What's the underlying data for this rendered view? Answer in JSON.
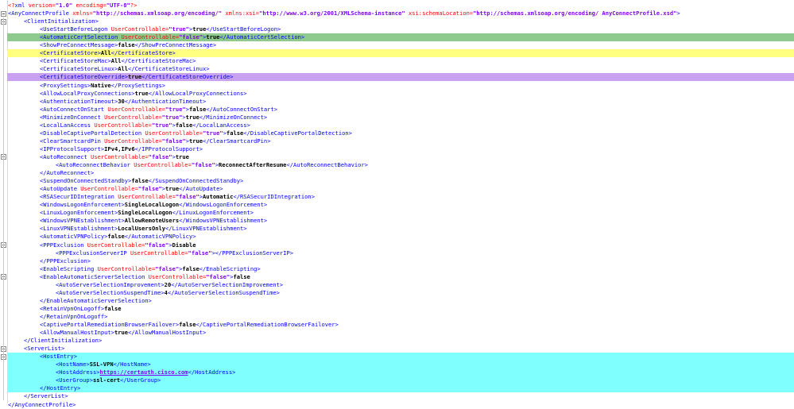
{
  "editor": {
    "lines": [
      {
        "indent": 0,
        "highlight": "",
        "segments": [
          {
            "k": "q",
            "t": "<?"
          },
          {
            "k": "b",
            "t": "xml "
          },
          {
            "k": "a",
            "t": "version="
          },
          {
            "k": "v",
            "t": "\"1.0\""
          },
          {
            "k": "a",
            "t": " encoding="
          },
          {
            "k": "v",
            "t": "\"UTF-8\""
          },
          {
            "k": "q",
            "t": "?>"
          }
        ]
      },
      {
        "indent": 0,
        "highlight": "",
        "segments": [
          {
            "k": "b",
            "t": "<AnyConnectProfile "
          },
          {
            "k": "a",
            "t": "xmlns="
          },
          {
            "k": "v",
            "t": "\"http://schemas.xmlsoap.org/encoding/\""
          },
          {
            "k": "a",
            "t": " xmlns:xsi="
          },
          {
            "k": "v",
            "t": "\"http://www.w3.org/2001/XMLSchema-instance\""
          },
          {
            "k": "a",
            "t": " xsi:schemaLocation="
          },
          {
            "k": "v",
            "t": "\"http://schemas.xmlsoap.org/encoding/ AnyConnectProfile.xsd\""
          },
          {
            "k": "b",
            "t": ">"
          }
        ]
      },
      {
        "indent": 1,
        "highlight": "",
        "segments": [
          {
            "k": "b",
            "t": "<ClientInitialization>"
          }
        ]
      },
      {
        "indent": 2,
        "highlight": "",
        "segments": [
          {
            "k": "b",
            "t": "<UseStartBeforeLogon "
          },
          {
            "k": "a",
            "t": "UserControllable="
          },
          {
            "k": "v",
            "t": "\"true\""
          },
          {
            "k": "b",
            "t": ">"
          },
          {
            "k": "t",
            "t": "true"
          },
          {
            "k": "b",
            "t": "</UseStartBeforeLogon>"
          }
        ]
      },
      {
        "indent": 2,
        "highlight": "green",
        "segments": [
          {
            "k": "b",
            "t": "<AutomaticCertSelection "
          },
          {
            "k": "a",
            "t": "UserControllable="
          },
          {
            "k": "v",
            "t": "\"false\""
          },
          {
            "k": "b",
            "t": ">"
          },
          {
            "k": "t",
            "t": "true"
          },
          {
            "k": "b",
            "t": "</AutomaticCertSelection>"
          }
        ]
      },
      {
        "indent": 2,
        "highlight": "",
        "segments": [
          {
            "k": "b",
            "t": "<ShowPreConnectMessage>"
          },
          {
            "k": "t",
            "t": "false"
          },
          {
            "k": "b",
            "t": "</ShowPreConnectMessage>"
          }
        ]
      },
      {
        "indent": 2,
        "highlight": "yellow",
        "segments": [
          {
            "k": "b",
            "t": "<CertificateStore>"
          },
          {
            "k": "t",
            "t": "All"
          },
          {
            "k": "b",
            "t": "</CertificateStore>"
          }
        ]
      },
      {
        "indent": 2,
        "highlight": "",
        "segments": [
          {
            "k": "b",
            "t": "<CertificateStoreMac>"
          },
          {
            "k": "t",
            "t": "All"
          },
          {
            "k": "b",
            "t": "</CertificateStoreMac>"
          }
        ]
      },
      {
        "indent": 2,
        "highlight": "",
        "segments": [
          {
            "k": "b",
            "t": "<CertificateStoreLinux>"
          },
          {
            "k": "t",
            "t": "All"
          },
          {
            "k": "b",
            "t": "</CertificateStoreLinux>"
          }
        ]
      },
      {
        "indent": 2,
        "highlight": "purple",
        "segments": [
          {
            "k": "b",
            "t": "<CertificateStoreOverride>"
          },
          {
            "k": "t",
            "t": "true"
          },
          {
            "k": "b",
            "t": "</CertificateStoreOverride>"
          }
        ]
      },
      {
        "indent": 2,
        "highlight": "",
        "segments": [
          {
            "k": "b",
            "t": "<ProxySettings>"
          },
          {
            "k": "t",
            "t": "Native"
          },
          {
            "k": "b",
            "t": "</ProxySettings>"
          }
        ]
      },
      {
        "indent": 2,
        "highlight": "",
        "segments": [
          {
            "k": "b",
            "t": "<AllowLocalProxyConnections>"
          },
          {
            "k": "t",
            "t": "true"
          },
          {
            "k": "b",
            "t": "</AllowLocalProxyConnections>"
          }
        ]
      },
      {
        "indent": 2,
        "highlight": "",
        "segments": [
          {
            "k": "b",
            "t": "<AuthenticationTimeout>"
          },
          {
            "k": "t",
            "t": "30"
          },
          {
            "k": "b",
            "t": "</AuthenticationTimeout>"
          }
        ]
      },
      {
        "indent": 2,
        "highlight": "",
        "segments": [
          {
            "k": "b",
            "t": "<AutoConnectOnStart "
          },
          {
            "k": "a",
            "t": "UserControllable="
          },
          {
            "k": "v",
            "t": "\"true\""
          },
          {
            "k": "b",
            "t": ">"
          },
          {
            "k": "t",
            "t": "false"
          },
          {
            "k": "b",
            "t": "</AutoConnectOnStart>"
          }
        ]
      },
      {
        "indent": 2,
        "highlight": "",
        "segments": [
          {
            "k": "b",
            "t": "<MinimizeOnConnect "
          },
          {
            "k": "a",
            "t": "UserControllable="
          },
          {
            "k": "v",
            "t": "\"true\""
          },
          {
            "k": "b",
            "t": ">"
          },
          {
            "k": "t",
            "t": "true"
          },
          {
            "k": "b",
            "t": "</MinimizeOnConnect>"
          }
        ]
      },
      {
        "indent": 2,
        "highlight": "",
        "segments": [
          {
            "k": "b",
            "t": "<LocalLanAccess "
          },
          {
            "k": "a",
            "t": "UserControllable="
          },
          {
            "k": "v",
            "t": "\"true\""
          },
          {
            "k": "b",
            "t": ">"
          },
          {
            "k": "t",
            "t": "false"
          },
          {
            "k": "b",
            "t": "</LocalLanAccess>"
          }
        ]
      },
      {
        "indent": 2,
        "highlight": "",
        "segments": [
          {
            "k": "b",
            "t": "<DisableCaptivePortalDetection "
          },
          {
            "k": "a",
            "t": "UserControllable="
          },
          {
            "k": "v",
            "t": "\"true\""
          },
          {
            "k": "b",
            "t": ">"
          },
          {
            "k": "t",
            "t": "false"
          },
          {
            "k": "b",
            "t": "</DisableCaptivePortalDetection>"
          }
        ]
      },
      {
        "indent": 2,
        "highlight": "",
        "segments": [
          {
            "k": "b",
            "t": "<ClearSmartcardPin "
          },
          {
            "k": "a",
            "t": "UserControllable="
          },
          {
            "k": "v",
            "t": "\"false\""
          },
          {
            "k": "b",
            "t": ">"
          },
          {
            "k": "t",
            "t": "true"
          },
          {
            "k": "b",
            "t": "</ClearSmartcardPin>"
          }
        ]
      },
      {
        "indent": 2,
        "highlight": "",
        "segments": [
          {
            "k": "b",
            "t": "<IPProtocolSupport>"
          },
          {
            "k": "t",
            "t": "IPv4,IPv6"
          },
          {
            "k": "b",
            "t": "</IPProtocolSupport>"
          }
        ]
      },
      {
        "indent": 2,
        "highlight": "",
        "segments": [
          {
            "k": "b",
            "t": "<AutoReconnect "
          },
          {
            "k": "a",
            "t": "UserControllable="
          },
          {
            "k": "v",
            "t": "\"false\""
          },
          {
            "k": "b",
            "t": ">"
          },
          {
            "k": "t",
            "t": "true"
          }
        ]
      },
      {
        "indent": 3,
        "highlight": "",
        "segments": [
          {
            "k": "b",
            "t": "<AutoReconnectBehavior "
          },
          {
            "k": "a",
            "t": "UserControllable="
          },
          {
            "k": "v",
            "t": "\"false\""
          },
          {
            "k": "b",
            "t": ">"
          },
          {
            "k": "t",
            "t": "ReconnectAfterResume"
          },
          {
            "k": "b",
            "t": "</AutoReconnectBehavior>"
          }
        ]
      },
      {
        "indent": 2,
        "highlight": "",
        "segments": [
          {
            "k": "b",
            "t": "</AutoReconnect>"
          }
        ]
      },
      {
        "indent": 2,
        "highlight": "",
        "segments": [
          {
            "k": "b",
            "t": "<SuspendOnConnectedStandby>"
          },
          {
            "k": "t",
            "t": "false"
          },
          {
            "k": "b",
            "t": "</SuspendOnConnectedStandby>"
          }
        ]
      },
      {
        "indent": 2,
        "highlight": "",
        "segments": [
          {
            "k": "b",
            "t": "<AutoUpdate "
          },
          {
            "k": "a",
            "t": "UserControllable="
          },
          {
            "k": "v",
            "t": "\"false\""
          },
          {
            "k": "b",
            "t": ">"
          },
          {
            "k": "t",
            "t": "true"
          },
          {
            "k": "b",
            "t": "</AutoUpdate>"
          }
        ]
      },
      {
        "indent": 2,
        "highlight": "",
        "segments": [
          {
            "k": "b",
            "t": "<RSASecurIDIntegration "
          },
          {
            "k": "a",
            "t": "UserControllable="
          },
          {
            "k": "v",
            "t": "\"false\""
          },
          {
            "k": "b",
            "t": ">"
          },
          {
            "k": "t",
            "t": "Automatic"
          },
          {
            "k": "b",
            "t": "</RSASecurIDIntegration>"
          }
        ]
      },
      {
        "indent": 2,
        "highlight": "",
        "segments": [
          {
            "k": "b",
            "t": "<WindowsLogonEnforcement>"
          },
          {
            "k": "t",
            "t": "SingleLocalLogon"
          },
          {
            "k": "b",
            "t": "</WindowsLogonEnforcement>"
          }
        ]
      },
      {
        "indent": 2,
        "highlight": "",
        "segments": [
          {
            "k": "b",
            "t": "<LinuxLogonEnforcement>"
          },
          {
            "k": "t",
            "t": "SingleLocalLogon"
          },
          {
            "k": "b",
            "t": "</LinuxLogonEnforcement>"
          }
        ]
      },
      {
        "indent": 2,
        "highlight": "",
        "segments": [
          {
            "k": "b",
            "t": "<WindowsVPNEstablishment>"
          },
          {
            "k": "t",
            "t": "AllowRemoteUsers"
          },
          {
            "k": "b",
            "t": "</WindowsVPNEstablishment>"
          }
        ]
      },
      {
        "indent": 2,
        "highlight": "",
        "segments": [
          {
            "k": "b",
            "t": "<LinuxVPNEstablishment>"
          },
          {
            "k": "t",
            "t": "LocalUsersOnly"
          },
          {
            "k": "b",
            "t": "</LinuxVPNEstablishment>"
          }
        ]
      },
      {
        "indent": 2,
        "highlight": "",
        "segments": [
          {
            "k": "b",
            "t": "<AutomaticVPNPolicy>"
          },
          {
            "k": "t",
            "t": "false"
          },
          {
            "k": "b",
            "t": "</AutomaticVPNPolicy>"
          }
        ]
      },
      {
        "indent": 2,
        "highlight": "",
        "segments": [
          {
            "k": "b",
            "t": "<PPPExclusion "
          },
          {
            "k": "a",
            "t": "UserControllable="
          },
          {
            "k": "v",
            "t": "\"false\""
          },
          {
            "k": "b",
            "t": ">"
          },
          {
            "k": "t",
            "t": "Disable"
          }
        ]
      },
      {
        "indent": 3,
        "highlight": "",
        "segments": [
          {
            "k": "b",
            "t": "<PPPExclusionServerIP "
          },
          {
            "k": "a",
            "t": "UserControllable="
          },
          {
            "k": "v",
            "t": "\"false\""
          },
          {
            "k": "b",
            "t": "></PPPExclusionServerIP>"
          }
        ]
      },
      {
        "indent": 2,
        "highlight": "",
        "segments": [
          {
            "k": "b",
            "t": "</PPPExclusion>"
          }
        ]
      },
      {
        "indent": 2,
        "highlight": "",
        "segments": [
          {
            "k": "b",
            "t": "<EnableScripting "
          },
          {
            "k": "a",
            "t": "UserControllable="
          },
          {
            "k": "v",
            "t": "\"false\""
          },
          {
            "k": "b",
            "t": ">"
          },
          {
            "k": "t",
            "t": "false"
          },
          {
            "k": "b",
            "t": "</EnableScripting>"
          }
        ]
      },
      {
        "indent": 2,
        "highlight": "",
        "segments": [
          {
            "k": "b",
            "t": "<EnableAutomaticServerSelection "
          },
          {
            "k": "a",
            "t": "UserControllable="
          },
          {
            "k": "v",
            "t": "\"false\""
          },
          {
            "k": "b",
            "t": ">"
          },
          {
            "k": "t",
            "t": "false"
          }
        ]
      },
      {
        "indent": 3,
        "highlight": "",
        "segments": [
          {
            "k": "b",
            "t": "<AutoServerSelectionImprovement>"
          },
          {
            "k": "t",
            "t": "20"
          },
          {
            "k": "b",
            "t": "</AutoServerSelectionImprovement>"
          }
        ]
      },
      {
        "indent": 3,
        "highlight": "",
        "segments": [
          {
            "k": "b",
            "t": "<AutoServerSelectionSuspendTime>"
          },
          {
            "k": "t",
            "t": "4"
          },
          {
            "k": "b",
            "t": "</AutoServerSelectionSuspendTime>"
          }
        ]
      },
      {
        "indent": 2,
        "highlight": "",
        "segments": [
          {
            "k": "b",
            "t": "</EnableAutomaticServerSelection>"
          }
        ]
      },
      {
        "indent": 2,
        "highlight": "",
        "segments": [
          {
            "k": "b",
            "t": "<RetainVpnOnLogoff>"
          },
          {
            "k": "t",
            "t": "false"
          }
        ]
      },
      {
        "indent": 2,
        "highlight": "",
        "segments": [
          {
            "k": "b",
            "t": "</RetainVpnOnLogoff>"
          }
        ]
      },
      {
        "indent": 2,
        "highlight": "",
        "segments": [
          {
            "k": "b",
            "t": "<CaptivePortalRemediationBrowserFailover>"
          },
          {
            "k": "t",
            "t": "false"
          },
          {
            "k": "b",
            "t": "</CaptivePortalRemediationBrowserFailover>"
          }
        ]
      },
      {
        "indent": 2,
        "highlight": "",
        "segments": [
          {
            "k": "b",
            "t": "<AllowManualHostInput>"
          },
          {
            "k": "t",
            "t": "true"
          },
          {
            "k": "b",
            "t": "</AllowManualHostInput>"
          }
        ]
      },
      {
        "indent": 1,
        "highlight": "",
        "segments": [
          {
            "k": "b",
            "t": "</ClientInitialization>"
          }
        ]
      },
      {
        "indent": 1,
        "highlight": "",
        "segments": [
          {
            "k": "b",
            "t": "<ServerList>"
          }
        ]
      },
      {
        "indent": 2,
        "highlight": "cyan",
        "segments": [
          {
            "k": "b",
            "t": "<HostEntry>"
          }
        ]
      },
      {
        "indent": 3,
        "highlight": "cyan",
        "segments": [
          {
            "k": "b",
            "t": "<HostName>"
          },
          {
            "k": "t",
            "t": "SSL-VPN"
          },
          {
            "k": "b",
            "t": "</HostName>"
          }
        ]
      },
      {
        "indent": 3,
        "highlight": "cyan",
        "segments": [
          {
            "k": "b",
            "t": "<HostAddress>"
          },
          {
            "k": "u",
            "t": "https://certauth.cisco.com"
          },
          {
            "k": "b",
            "t": "</HostAddress>"
          }
        ]
      },
      {
        "indent": 3,
        "highlight": "cyan",
        "segments": [
          {
            "k": "b",
            "t": "<UserGroup>"
          },
          {
            "k": "t",
            "t": "ssl-cert"
          },
          {
            "k": "b",
            "t": "</UserGroup>"
          }
        ]
      },
      {
        "indent": 2,
        "highlight": "cyan",
        "segments": [
          {
            "k": "b",
            "t": "</HostEntry>"
          }
        ]
      },
      {
        "indent": 1,
        "highlight": "",
        "segments": [
          {
            "k": "b",
            "t": "</ServerList>"
          }
        ]
      },
      {
        "indent": 0,
        "highlight": "",
        "segments": [
          {
            "k": "b",
            "t": "</AnyConnectProfile>"
          }
        ]
      }
    ]
  }
}
